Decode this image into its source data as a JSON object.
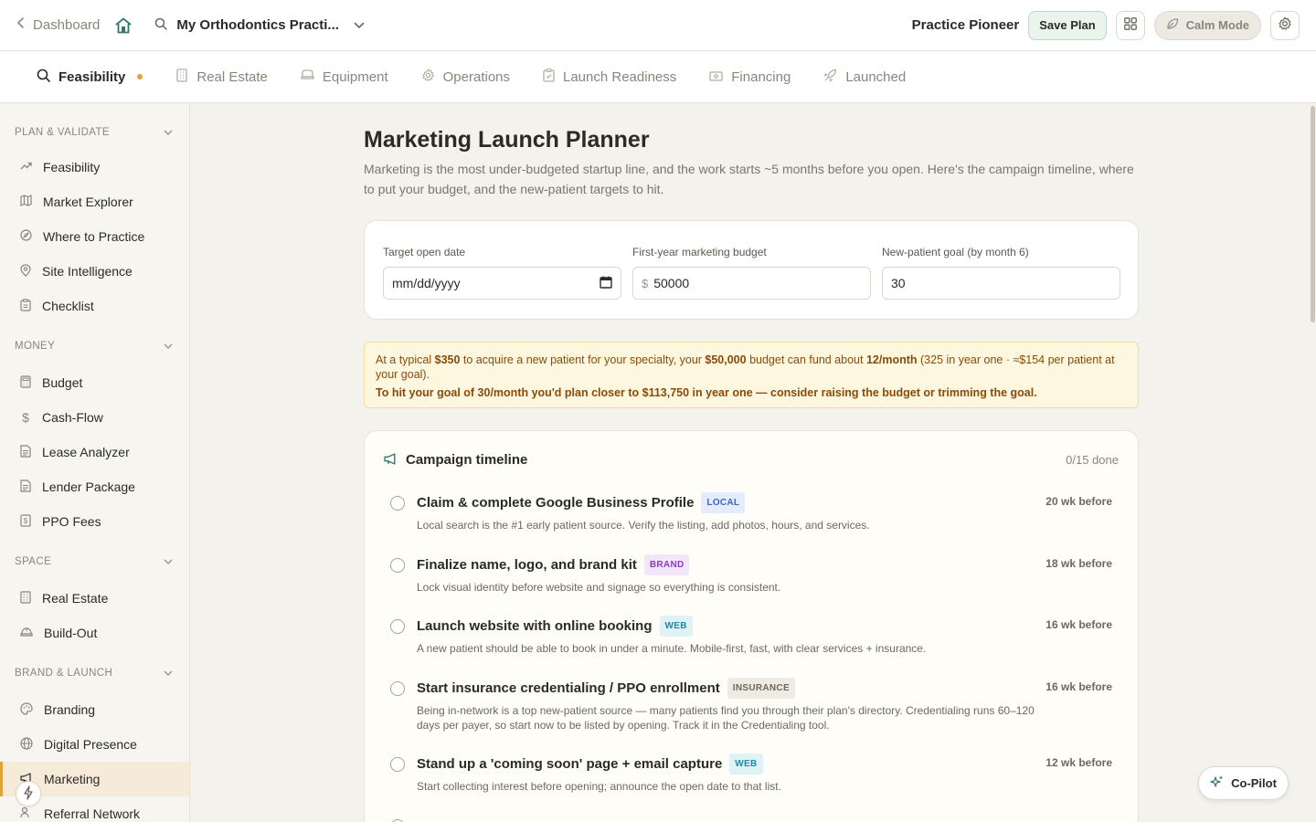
{
  "topbar": {
    "back_label": "Dashboard",
    "practice_name": "My Orthodontics Practi...",
    "user_name": "Practice Pioneer",
    "save_label": "Save Plan",
    "calm_label": "Calm Mode"
  },
  "tabs": [
    {
      "label": "Feasibility",
      "icon": "search-icon",
      "active": true
    },
    {
      "label": "Real Estate",
      "icon": "building-icon"
    },
    {
      "label": "Equipment",
      "icon": "chair-icon"
    },
    {
      "label": "Operations",
      "icon": "gear-icon"
    },
    {
      "label": "Launch Readiness",
      "icon": "clipboard-icon"
    },
    {
      "label": "Financing",
      "icon": "banknote-icon"
    },
    {
      "label": "Launched",
      "icon": "rocket-icon"
    }
  ],
  "sidebar": {
    "sections": [
      {
        "title": "PLAN & VALIDATE",
        "items": [
          "Feasibility",
          "Market Explorer",
          "Where to Practice",
          "Site Intelligence",
          "Checklist"
        ]
      },
      {
        "title": "MONEY",
        "items": [
          "Budget",
          "Cash-Flow",
          "Lease Analyzer",
          "Lender Package",
          "PPO Fees"
        ]
      },
      {
        "title": "SPACE",
        "items": [
          "Real Estate",
          "Build-Out"
        ]
      },
      {
        "title": "BRAND & LAUNCH",
        "items": [
          "Branding",
          "Digital Presence",
          "Marketing",
          "Referral Network"
        ]
      }
    ],
    "active_item": "Marketing"
  },
  "page": {
    "title": "Marketing Launch Planner",
    "description": "Marketing is the most under-budgeted startup line, and the work starts ~5 months before you open. Here's the campaign timeline, where to put your budget, and the new-patient targets to hit."
  },
  "inputs": {
    "open_date_label": "Target open date",
    "open_date_placeholder": "mm/dd/yyyy",
    "budget_label": "First-year marketing budget",
    "budget_prefix": "$",
    "budget_value": "50000",
    "goal_label": "New-patient goal (by month 6)",
    "goal_value": "30"
  },
  "notice": {
    "t1": "At a typical ",
    "acq_cost": "$350",
    "t2": " to acquire a new patient for your specialty, your ",
    "budget": "$50,000",
    "t3": " budget can fund about ",
    "per_month": "12/month",
    "t4": " (325 in year one · ≈$154 per patient at your goal).",
    "line2": "To hit your goal of 30/month you'd plan closer to $113,750 in year one — consider raising the budget or trimming the goal."
  },
  "timeline": {
    "title": "Campaign timeline",
    "count": "0/15 done",
    "tasks": [
      {
        "title": "Claim & complete Google Business Profile",
        "tag": "LOCAL",
        "when": "20 wk before",
        "desc": "Local search is the #1 early patient source. Verify the listing, add photos, hours, and services."
      },
      {
        "title": "Finalize name, logo, and brand kit",
        "tag": "BRAND",
        "when": "18 wk before",
        "desc": "Lock visual identity before website and signage so everything is consistent."
      },
      {
        "title": "Launch website with online booking",
        "tag": "WEB",
        "when": "16 wk before",
        "desc": "A new patient should be able to book in under a minute. Mobile-first, fast, with clear services + insurance."
      },
      {
        "title": "Start insurance credentialing / PPO enrollment",
        "tag": "INSURANCE",
        "when": "16 wk before",
        "desc": "Being in-network is a top new-patient source — many patients find you through their plan's directory. Credentialing runs 60–120 days per payer, so start now to be listed by opening. Track it in the Credentialing tool."
      },
      {
        "title": "Stand up a 'coming soon' page + email capture",
        "tag": "WEB",
        "when": "12 wk before",
        "desc": "Start collecting interest before opening; announce the open date to that list."
      }
    ]
  },
  "copilot_label": "Co-Pilot",
  "colors": {
    "accent": "#e0a43a",
    "brand_green": "#2f7a6b",
    "notice_bg": "#fdf7e0"
  }
}
